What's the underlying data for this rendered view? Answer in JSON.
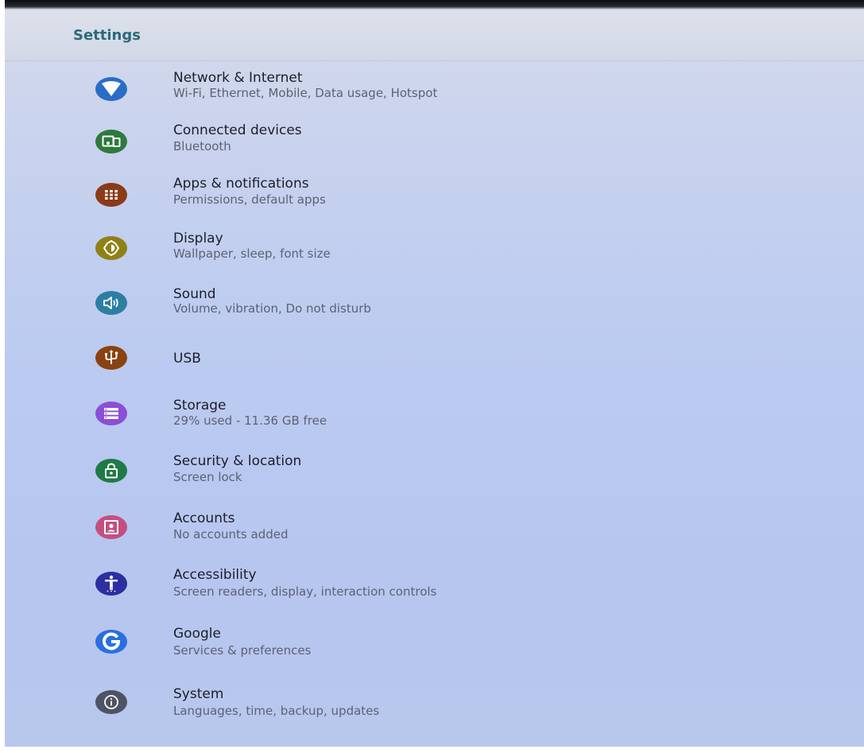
{
  "header": {
    "title": "Settings"
  },
  "items": [
    {
      "name": "network",
      "title": "Network & Internet",
      "subtitle": "Wi-Fi, Ethernet, Mobile, Data usage, Hotspot",
      "icon": "wifi-icon",
      "color": "#2a6dc6"
    },
    {
      "name": "connected-devices",
      "title": "Connected devices",
      "subtitle": "Bluetooth",
      "icon": "devices-icon",
      "color": "#2e7a3c"
    },
    {
      "name": "apps",
      "title": "Apps & notifications",
      "subtitle": "Permissions, default apps",
      "icon": "apps-grid-icon",
      "color": "#8a3b17"
    },
    {
      "name": "display",
      "title": "Display",
      "subtitle": "Wallpaper, sleep, font size",
      "icon": "brightness-icon",
      "color": "#8e8216"
    },
    {
      "name": "sound",
      "title": "Sound",
      "subtitle": "Volume, vibration, Do not disturb",
      "icon": "speaker-icon",
      "color": "#2c7fa3"
    },
    {
      "name": "usb",
      "title": "USB",
      "subtitle": "",
      "icon": "usb-icon",
      "color": "#8a4210"
    },
    {
      "name": "storage",
      "title": "Storage",
      "subtitle": "29% used - 11.36 GB free",
      "icon": "storage-icon",
      "color": "#8a4fd6"
    },
    {
      "name": "security",
      "title": "Security & location",
      "subtitle": "Screen lock",
      "icon": "lock-icon",
      "color": "#1f7a43"
    },
    {
      "name": "accounts",
      "title": "Accounts",
      "subtitle": "No accounts added",
      "icon": "account-icon",
      "color": "#c44f7f"
    },
    {
      "name": "accessibility",
      "title": "Accessibility",
      "subtitle": "Screen readers, display, interaction controls",
      "icon": "accessibility-icon",
      "color": "#2b2fa0"
    },
    {
      "name": "google",
      "title": "Google",
      "subtitle": "Services & preferences",
      "icon": "google-icon",
      "color": "#2a6fe0"
    },
    {
      "name": "system",
      "title": "System",
      "subtitle": "Languages, time, backup, updates",
      "icon": "info-icon",
      "color": "#4e5464"
    }
  ]
}
